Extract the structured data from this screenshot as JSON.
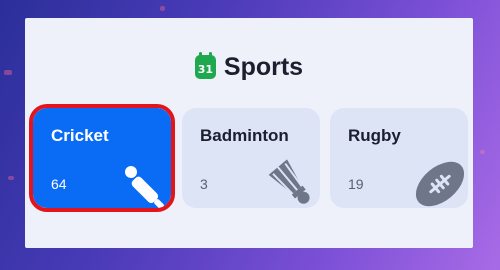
{
  "panel": {
    "title": "Sports",
    "calendar_icon": {
      "name": "calendar-icon",
      "day": "31",
      "color": "#1fa84f"
    }
  },
  "cards": [
    {
      "name": "Cricket",
      "count": "64",
      "icon": "cricket-icon",
      "selected": true,
      "bg": "#0a6cf5",
      "border": "#e4141d"
    },
    {
      "name": "Badminton",
      "count": "3",
      "icon": "shuttlecock-icon",
      "selected": false,
      "bg": "#dde4f6"
    },
    {
      "name": "Rugby",
      "count": "19",
      "icon": "rugby-ball-icon",
      "selected": false,
      "bg": "#dde4f6"
    }
  ]
}
